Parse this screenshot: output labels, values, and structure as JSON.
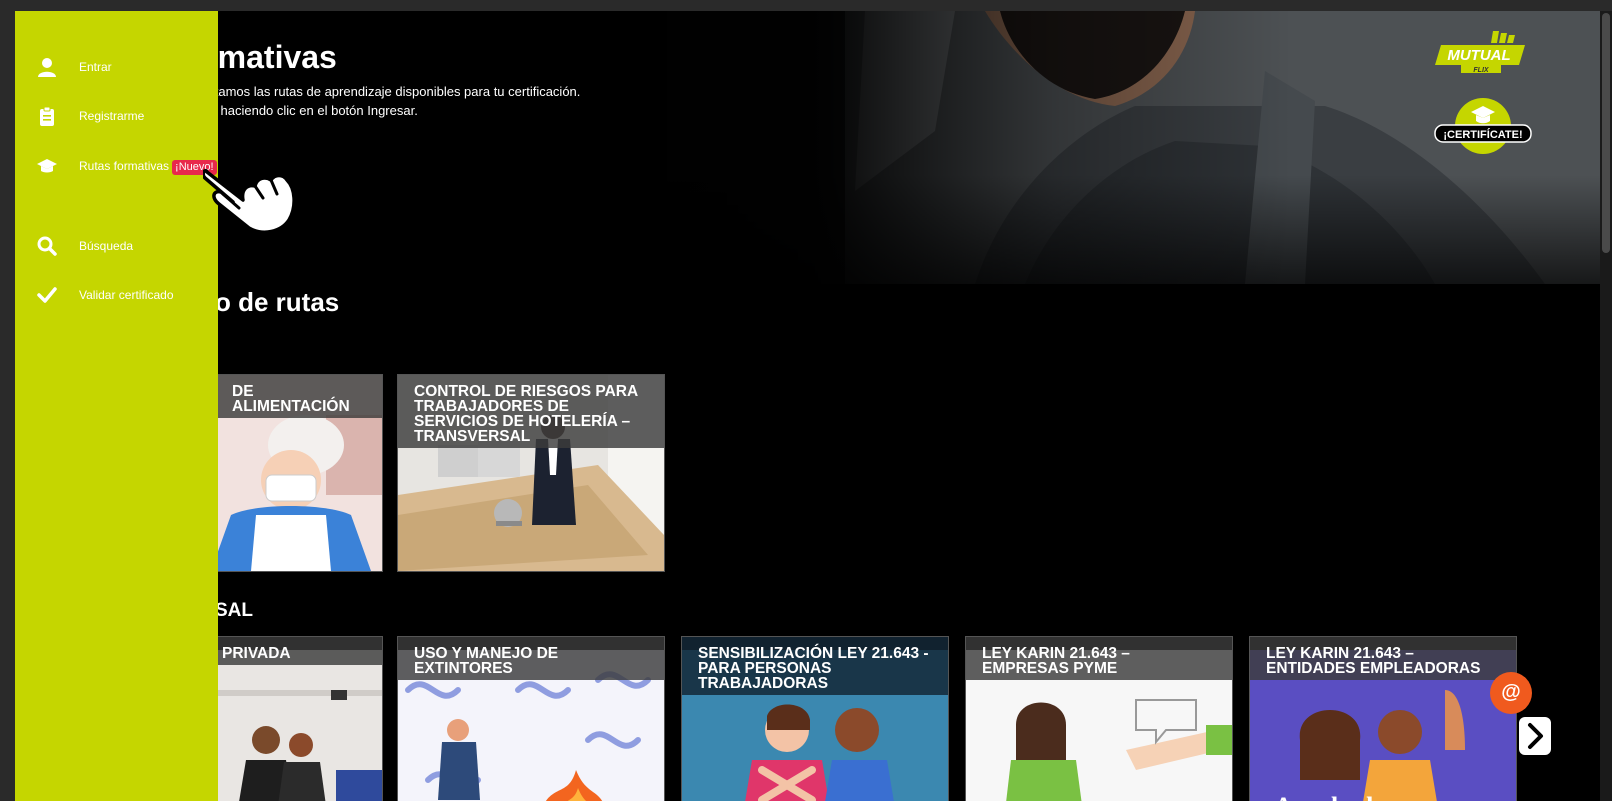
{
  "hero": {
    "title": "formativas",
    "line1": "presentamos las rutas de aprendizaje disponibles para tu certificación.",
    "line2": "ocerlas haciendo clic en el botón Ingresar."
  },
  "logo": {
    "text": "MUTUAL",
    "sub": "FLIX"
  },
  "cert_badge": {
    "label": "¡CERTIFÍCATE!"
  },
  "sections": [
    {
      "title": "o de rutas"
    },
    {
      "title": "SAL"
    }
  ],
  "row1": [
    {
      "label": "DE ALIMENTACIÓN"
    },
    {
      "label": "CONTROL DE RIESGOS PARA TRABAJADORES DE SERVICIOS DE HOTELERÍA – TRANSVERSAL"
    }
  ],
  "row2": [
    {
      "label": "PRIVADA"
    },
    {
      "label": "USO Y MANEJO DE EXTINTORES"
    },
    {
      "label": "SENSIBILIZACIÓN LEY 21.643 - PARA PERSONAS TRABAJADORAS"
    },
    {
      "label": "LEY KARIN 21.643 – EMPRESAS PYME"
    },
    {
      "label": "LEY KARIN 21.643 – ENTIDADES EMPLEADORAS"
    }
  ],
  "card_art_text": "Aprobada",
  "sidebar": {
    "items": [
      {
        "label": "Entrar",
        "icon": "user-icon"
      },
      {
        "label": "Registrarme",
        "icon": "clipboard-icon"
      },
      {
        "label": "Rutas formativas",
        "icon": "graduation-cap-icon",
        "badge": "¡Nuevo!"
      },
      {
        "label": "Búsqueda",
        "icon": "search-icon"
      },
      {
        "label": "Validar certificado",
        "icon": "check-icon"
      }
    ]
  },
  "fab": {
    "label": "@"
  },
  "colors": {
    "sidebar": "#c5d600",
    "badge_new": "#e8294b",
    "fab": "#f05a1e"
  }
}
